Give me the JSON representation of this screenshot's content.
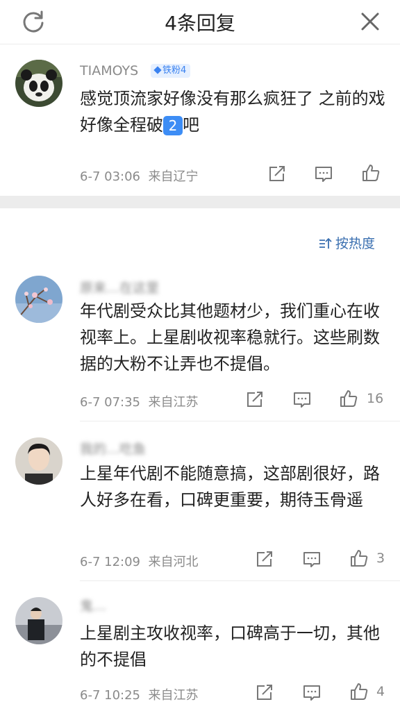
{
  "header": {
    "title": "4条回复"
  },
  "top_comment": {
    "username": "TIAMOYS",
    "badge": "铁粉4",
    "text_before": "感觉顶流家好像没有那么疯狂了 之前的戏好像全程破",
    "emoji": "2",
    "text_after": "吧",
    "time": "6-7 03:06",
    "location": "来自辽宁"
  },
  "sort": {
    "label": "按热度"
  },
  "replies": [
    {
      "username": "原来…在这里",
      "text": "年代剧受众比其他题材少，我们重心在收视率上。上星剧收视率稳就行。这些刷数据的大粉不让弄也不提倡。",
      "time": "6-7 07:35",
      "location": "来自江苏",
      "likes": "16"
    },
    {
      "username": "我的…吃鱼",
      "text": "上星年代剧不能随意搞，这部剧很好，路人好多在看，口碑更重要，期待玉骨遥",
      "time": "6-7 12:09",
      "location": "来自河北",
      "likes": "3"
    },
    {
      "username": "鬼…",
      "text": "上星剧主攻收视率，口碑高于一切，其他的不提倡",
      "time": "6-7 10:25",
      "location": "来自江苏",
      "likes": "4"
    }
  ],
  "colors": {
    "link": "#3a6fb0",
    "badge": "#3a82f0",
    "emoji_key": "#3d8df5",
    "meta": "#8a8a8a"
  }
}
